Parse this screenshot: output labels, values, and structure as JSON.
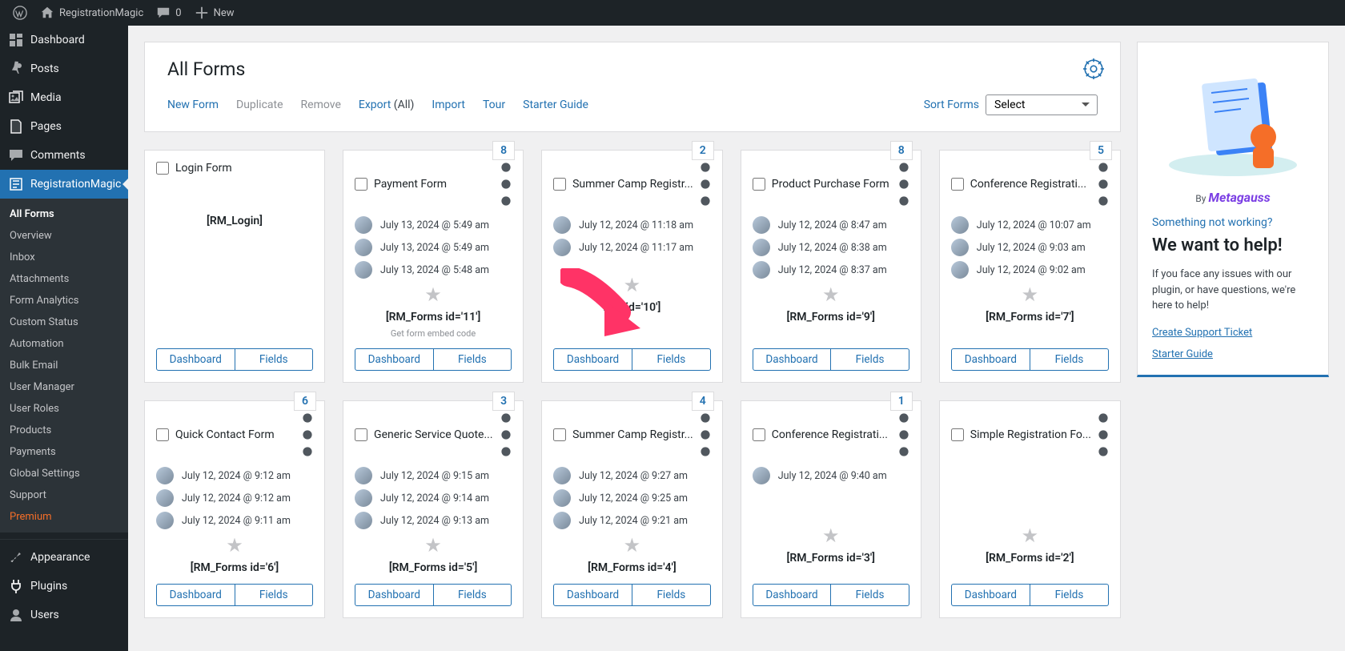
{
  "adminbar": {
    "site": "RegistrationMagic",
    "comments": "0",
    "new": "New"
  },
  "sidebar": {
    "main": [
      {
        "icon": "dashboard",
        "label": "Dashboard"
      },
      {
        "icon": "pin",
        "label": "Posts"
      },
      {
        "icon": "media",
        "label": "Media"
      },
      {
        "icon": "page",
        "label": "Pages"
      },
      {
        "icon": "comment",
        "label": "Comments"
      },
      {
        "icon": "rm",
        "label": "RegistrationMagic",
        "active": true
      }
    ],
    "sub": [
      {
        "label": "All Forms",
        "current": true
      },
      {
        "label": "Overview"
      },
      {
        "label": "Inbox"
      },
      {
        "label": "Attachments"
      },
      {
        "label": "Form Analytics"
      },
      {
        "label": "Custom Status"
      },
      {
        "label": "Automation"
      },
      {
        "label": "Bulk Email"
      },
      {
        "label": "User Manager"
      },
      {
        "label": "User Roles"
      },
      {
        "label": "Products"
      },
      {
        "label": "Payments"
      },
      {
        "label": "Global Settings"
      },
      {
        "label": "Support"
      },
      {
        "label": "Premium",
        "premium": true
      }
    ],
    "after": [
      {
        "icon": "brush",
        "label": "Appearance"
      },
      {
        "icon": "plug",
        "label": "Plugins"
      },
      {
        "icon": "user",
        "label": "Users"
      }
    ]
  },
  "page": {
    "title": "All Forms",
    "actions": {
      "new": "New Form",
      "duplicate": "Duplicate",
      "remove": "Remove",
      "export": "Export",
      "export_all": "(All)",
      "import": "Import",
      "tour": "Tour",
      "starter": "Starter Guide"
    },
    "sort_label": "Sort Forms",
    "sort_value": "Select",
    "dashboard_btn": "Dashboard",
    "fields_btn": "Fields",
    "embed_hint": "Get form embed code"
  },
  "cards": [
    {
      "title": "Login Form",
      "login": true,
      "shortcode": "[RM_Login]"
    },
    {
      "title": "Payment Form",
      "badge": "8",
      "shortcode": "[RM_Forms id='11']",
      "embed": true,
      "entries": [
        "July 13, 2024 @ 5:49 am",
        "July 13, 2024 @ 5:49 am",
        "July 13, 2024 @ 5:48 am"
      ]
    },
    {
      "title": "Summer Camp Registr...",
      "badge": "2",
      "shortcode": "rms id='10']",
      "entries": [
        "July 12, 2024 @ 11:18 am",
        "July 12, 2024 @ 11:17 am"
      ]
    },
    {
      "title": "Product Purchase Form",
      "badge": "8",
      "shortcode": "[RM_Forms id='9']",
      "entries": [
        "July 12, 2024 @ 8:47 am",
        "July 12, 2024 @ 8:38 am",
        "July 12, 2024 @ 8:37 am"
      ]
    },
    {
      "title": "Conference Registrati...",
      "badge": "5",
      "shortcode": "[RM_Forms id='7']",
      "entries": [
        "July 12, 2024 @ 10:07 am",
        "July 12, 2024 @ 9:03 am",
        "July 12, 2024 @ 9:02 am"
      ]
    },
    {
      "title": "Quick Contact Form",
      "badge": "6",
      "shortcode": "[RM_Forms id='6']",
      "entries": [
        "July 12, 2024 @ 9:12 am",
        "July 12, 2024 @ 9:12 am",
        "July 12, 2024 @ 9:11 am"
      ]
    },
    {
      "title": "Generic Service Quote...",
      "badge": "3",
      "shortcode": "[RM_Forms id='5']",
      "entries": [
        "July 12, 2024 @ 9:15 am",
        "July 12, 2024 @ 9:14 am",
        "July 12, 2024 @ 9:13 am"
      ]
    },
    {
      "title": "Summer Camp Registr...",
      "badge": "4",
      "shortcode": "[RM_Forms id='4']",
      "entries": [
        "July 12, 2024 @ 9:27 am",
        "July 12, 2024 @ 9:25 am",
        "July 12, 2024 @ 9:21 am"
      ]
    },
    {
      "title": "Conference Registrati...",
      "badge": "1",
      "shortcode": "[RM_Forms id='3']",
      "entries": [
        "July 12, 2024 @ 9:40 am"
      ]
    },
    {
      "title": "Simple Registration Fo...",
      "shortcode": "[RM_Forms id='2']"
    }
  ],
  "help": {
    "brand_prefix": "By",
    "brand": "Metagauss",
    "subtitle": "Something not working?",
    "title": "We want to help!",
    "body": "If you face any issues with our plugin, or have questions, we're here to help!",
    "link1": "Create Support Ticket",
    "link2": "Starter Guide"
  }
}
